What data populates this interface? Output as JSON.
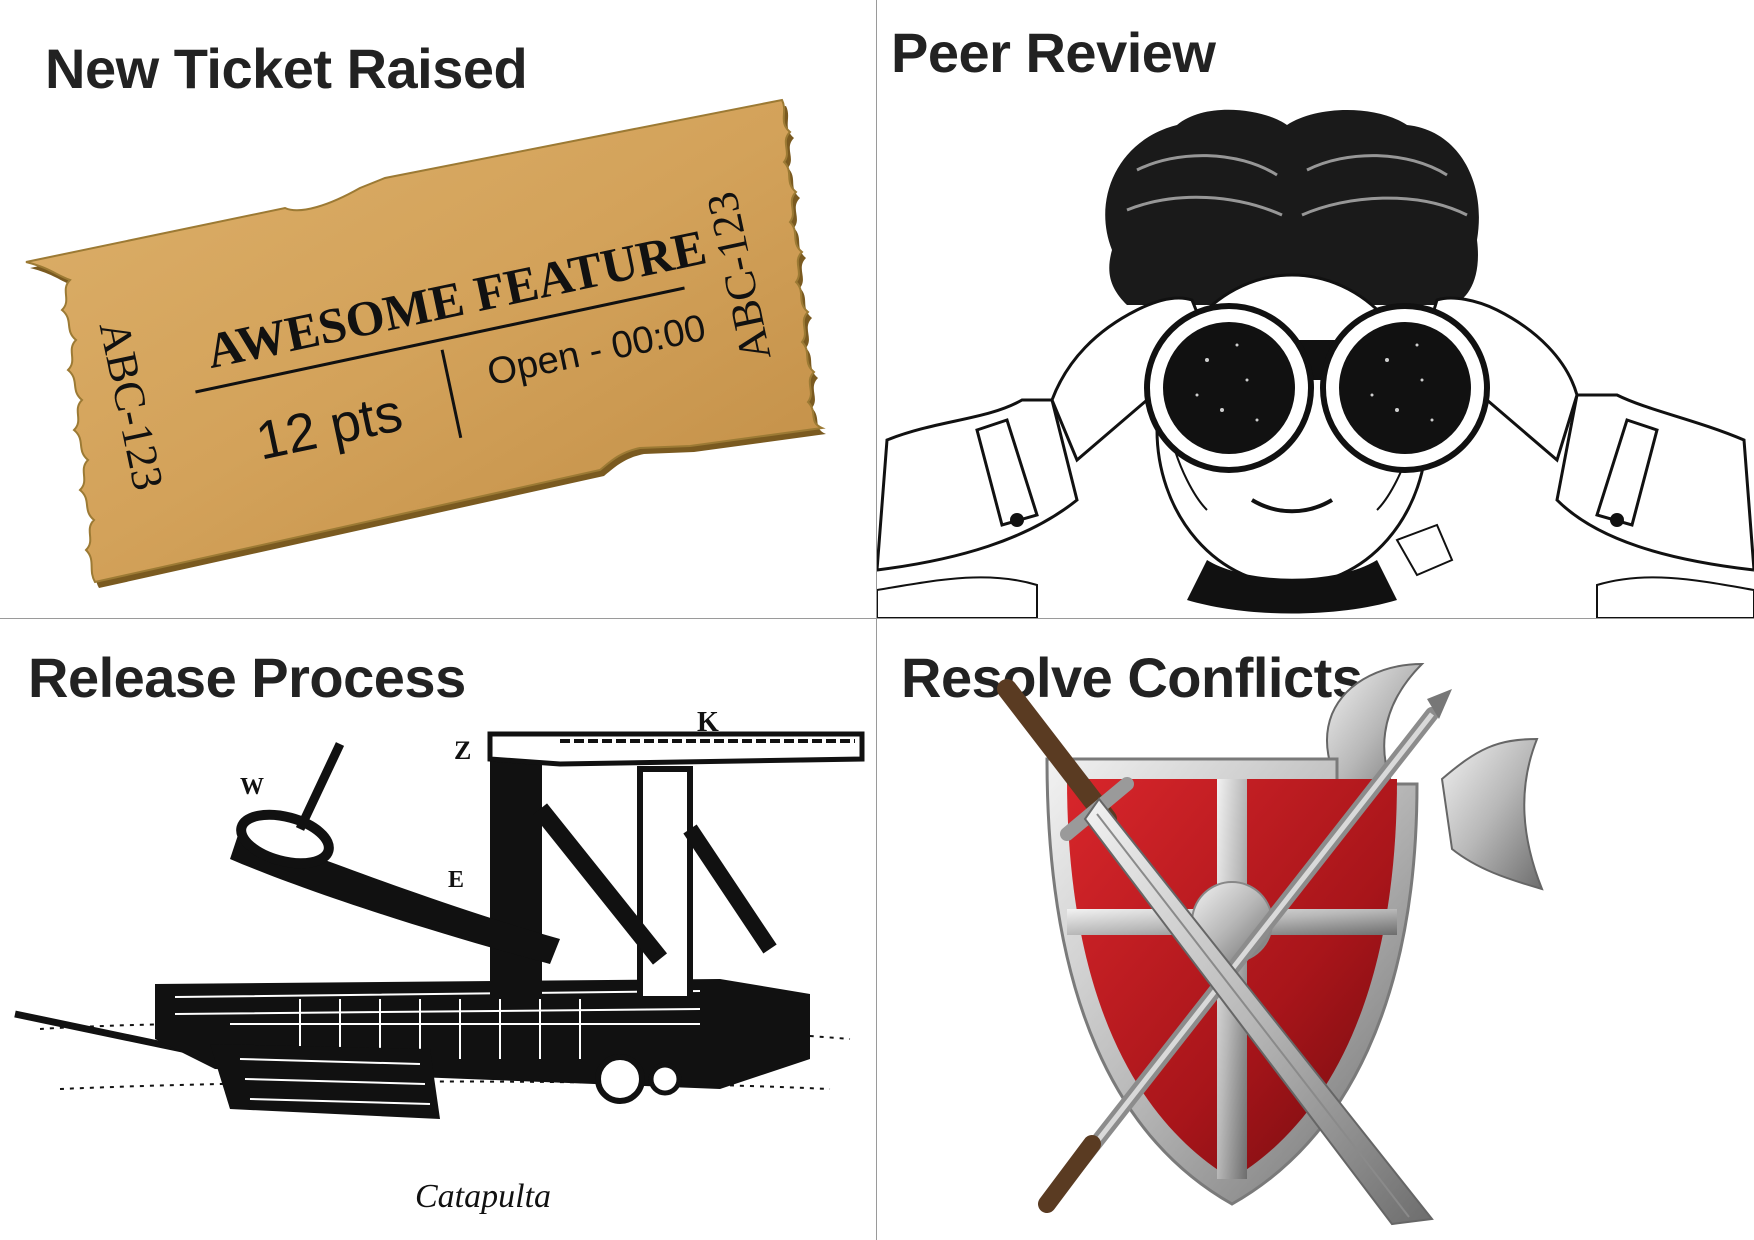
{
  "panels": {
    "top_left": {
      "title": "New Ticket Raised",
      "ticket": {
        "feature": "AWESOME FEATURE",
        "code": "ABC-123",
        "points": "12 pts",
        "status": "Open - 00:00",
        "color": "#d3a55c"
      }
    },
    "top_right": {
      "title": "Peer Review"
    },
    "bottom_left": {
      "title": "Release Process",
      "caption": "Catapulta",
      "label_k": "K",
      "label_z": "Z",
      "label_w": "W",
      "label_e": "E"
    },
    "bottom_right": {
      "title": "Resolve Conflicts",
      "shield_color": "#b0161b"
    }
  }
}
